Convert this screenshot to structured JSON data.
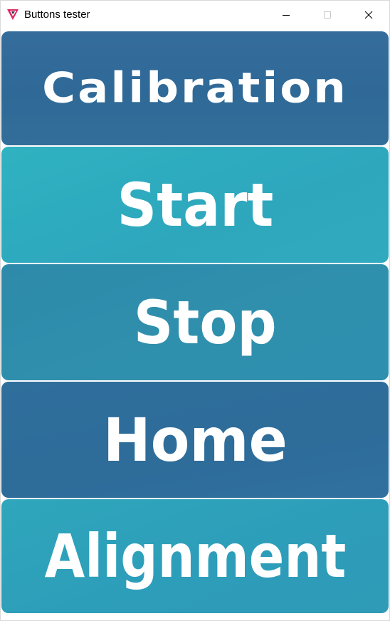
{
  "window": {
    "title": "Buttons tester",
    "app_icon": "app-logo-icon",
    "controls": {
      "minimize_icon": "minimize-icon",
      "maximize_icon": "maximize-icon",
      "close_icon": "close-icon"
    }
  },
  "buttons": [
    {
      "label": "Calibration",
      "color": "#2f6997"
    },
    {
      "label": "Start",
      "color": "#2ea7bd"
    },
    {
      "label": "Stop",
      "color": "#2f8fad"
    },
    {
      "label": "Home",
      "color": "#2e6c9a"
    },
    {
      "label": "Alignment",
      "color": "#2d9dba"
    }
  ]
}
